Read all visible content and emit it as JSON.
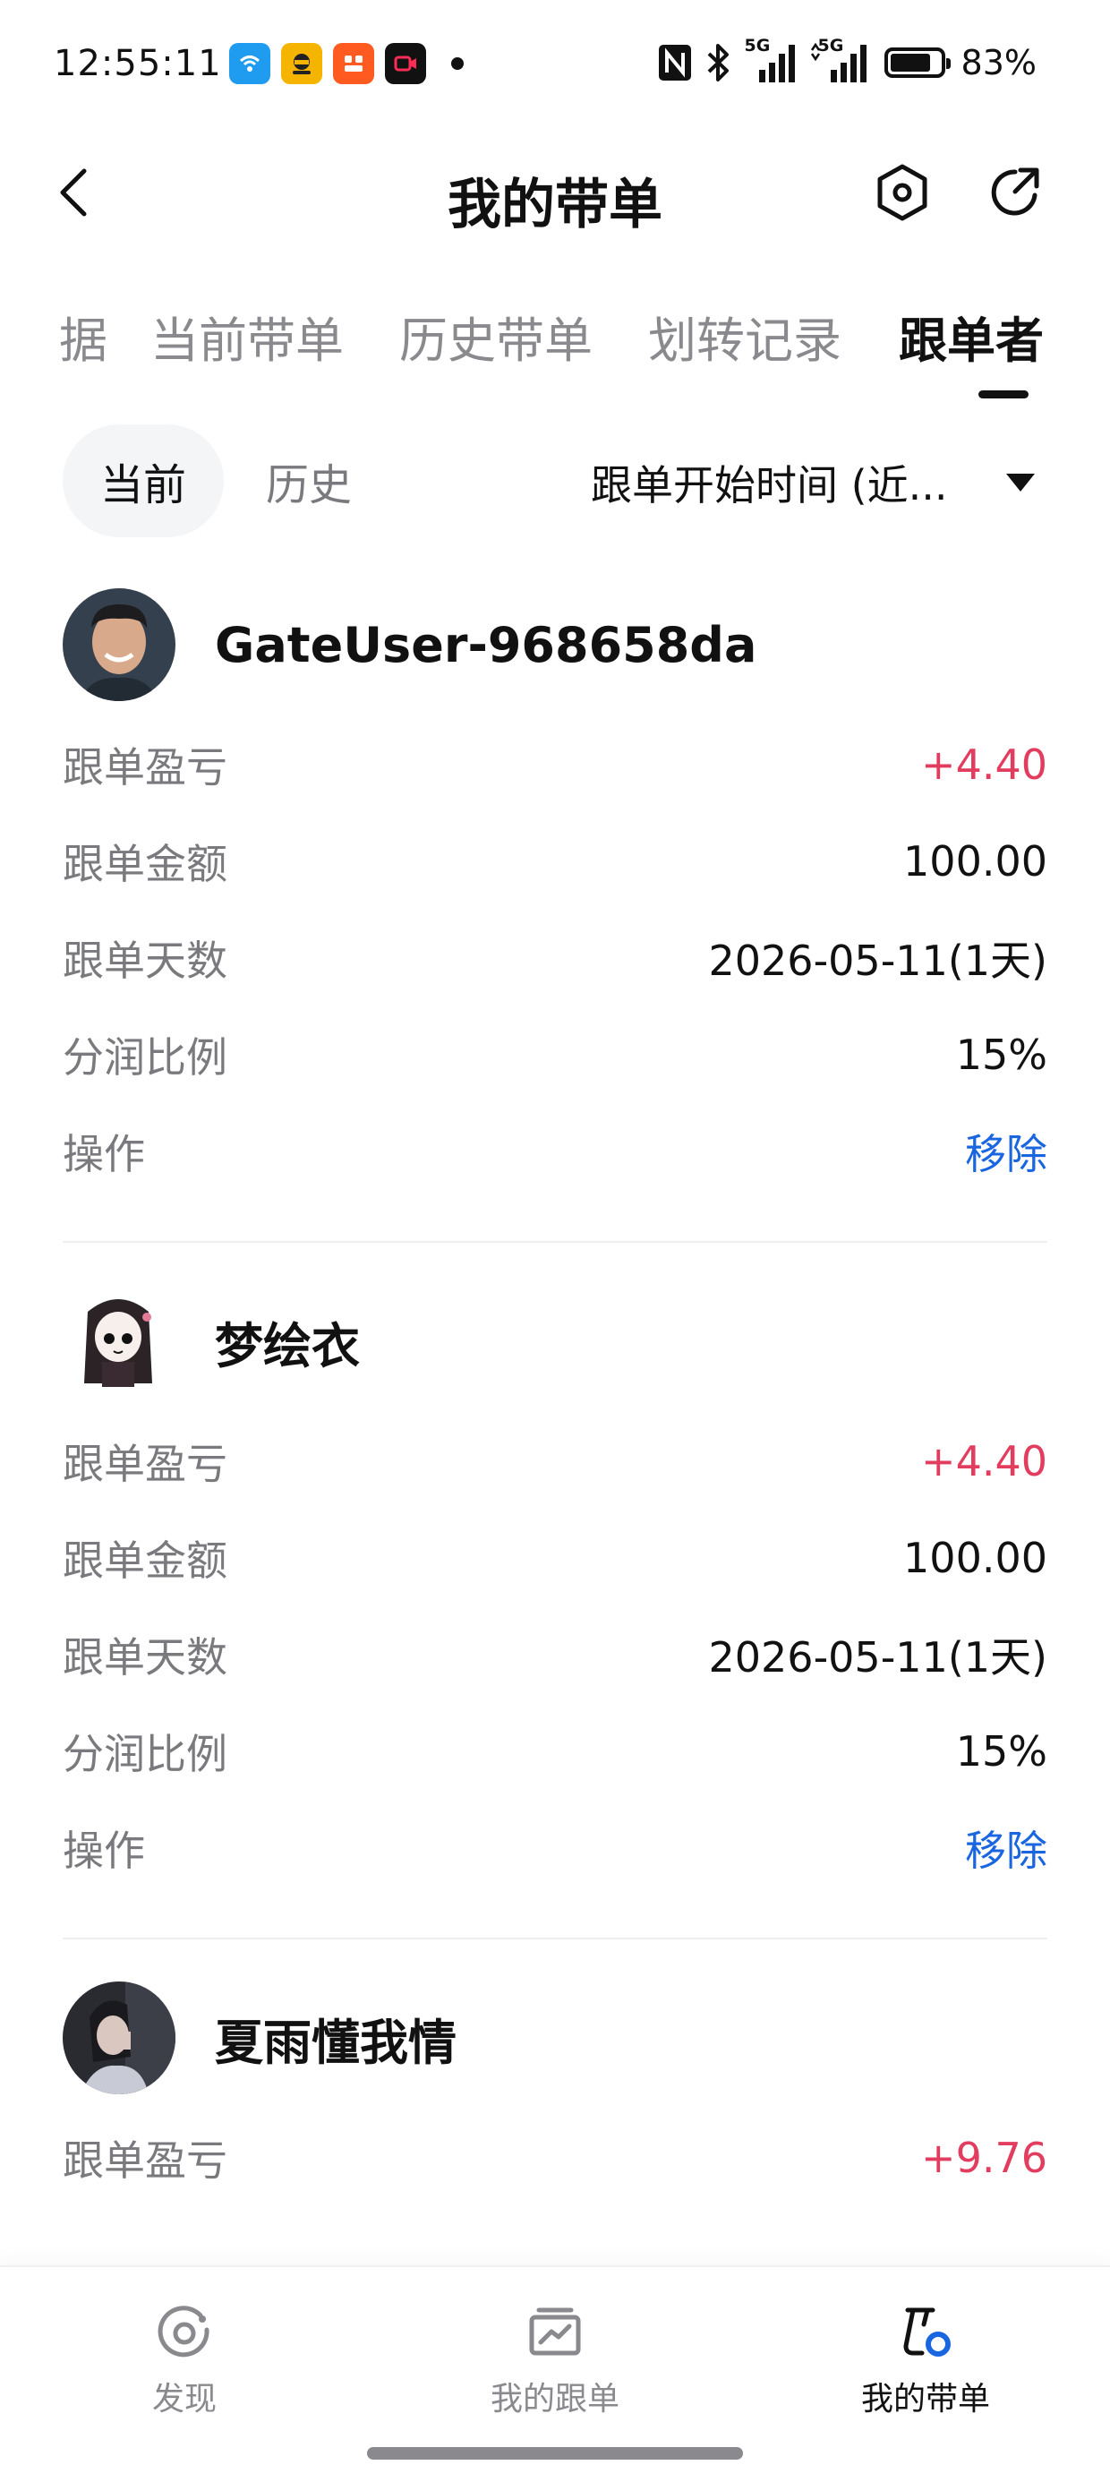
{
  "status_bar": {
    "time": "12:55:11",
    "network_label": "5G",
    "network_label_2": "5G",
    "battery_percent": 83,
    "battery_text": "83%",
    "icons": [
      "wifi-calling-app-icon",
      "taxi-app-icon",
      "shopping-app-icon",
      "video-app-icon",
      "notification-dot-icon",
      "nfc-icon",
      "bluetooth-icon",
      "signal-icon",
      "signal-icon-2",
      "battery-icon"
    ]
  },
  "header": {
    "title": "我的带单",
    "back_icon": "chevron-left-icon",
    "settings_icon": "hexagon-settings-icon",
    "share_icon": "share-arrow-icon"
  },
  "tabs": [
    {
      "label": "据",
      "active": false
    },
    {
      "label": "当前带单",
      "active": false
    },
    {
      "label": "历史带单",
      "active": false
    },
    {
      "label": "划转记录",
      "active": false
    },
    {
      "label": "跟单者",
      "active": true
    }
  ],
  "filter": {
    "segments": [
      {
        "label": "当前",
        "active": true
      },
      {
        "label": "历史",
        "active": false
      }
    ],
    "sort_label": "跟单开始时间 (近..."
  },
  "followers": [
    {
      "name": "GateUser-968658da",
      "rows": [
        {
          "label": "跟单盈亏",
          "value": "+4.40",
          "kind": "pos"
        },
        {
          "label": "跟单金额",
          "value": "100.00",
          "kind": "normal"
        },
        {
          "label": "跟单天数",
          "value": "2026-05-11(1天)",
          "kind": "normal"
        },
        {
          "label": "分润比例",
          "value": "15%",
          "kind": "normal"
        },
        {
          "label": "操作",
          "value": "移除",
          "kind": "link"
        }
      ]
    },
    {
      "name": "梦绘衣",
      "rows": [
        {
          "label": "跟单盈亏",
          "value": "+4.40",
          "kind": "pos"
        },
        {
          "label": "跟单金额",
          "value": "100.00",
          "kind": "normal"
        },
        {
          "label": "跟单天数",
          "value": "2026-05-11(1天)",
          "kind": "normal"
        },
        {
          "label": "分润比例",
          "value": "15%",
          "kind": "normal"
        },
        {
          "label": "操作",
          "value": "移除",
          "kind": "link"
        }
      ]
    },
    {
      "name": "夏雨懂我情",
      "rows": [
        {
          "label": "跟单盈亏",
          "value": "+9.76",
          "kind": "pos"
        }
      ]
    }
  ],
  "bottom_nav": [
    {
      "label": "发现",
      "icon": "discover-icon",
      "active": false
    },
    {
      "label": "我的跟单",
      "icon": "my-copy-trades-icon",
      "active": false
    },
    {
      "label": "我的带单",
      "icon": "my-lead-trades-icon",
      "active": true
    }
  ],
  "colors": {
    "positive": "#e23d5e",
    "link": "#1a66e0",
    "muted": "#7a7a7e",
    "text": "#111111"
  }
}
